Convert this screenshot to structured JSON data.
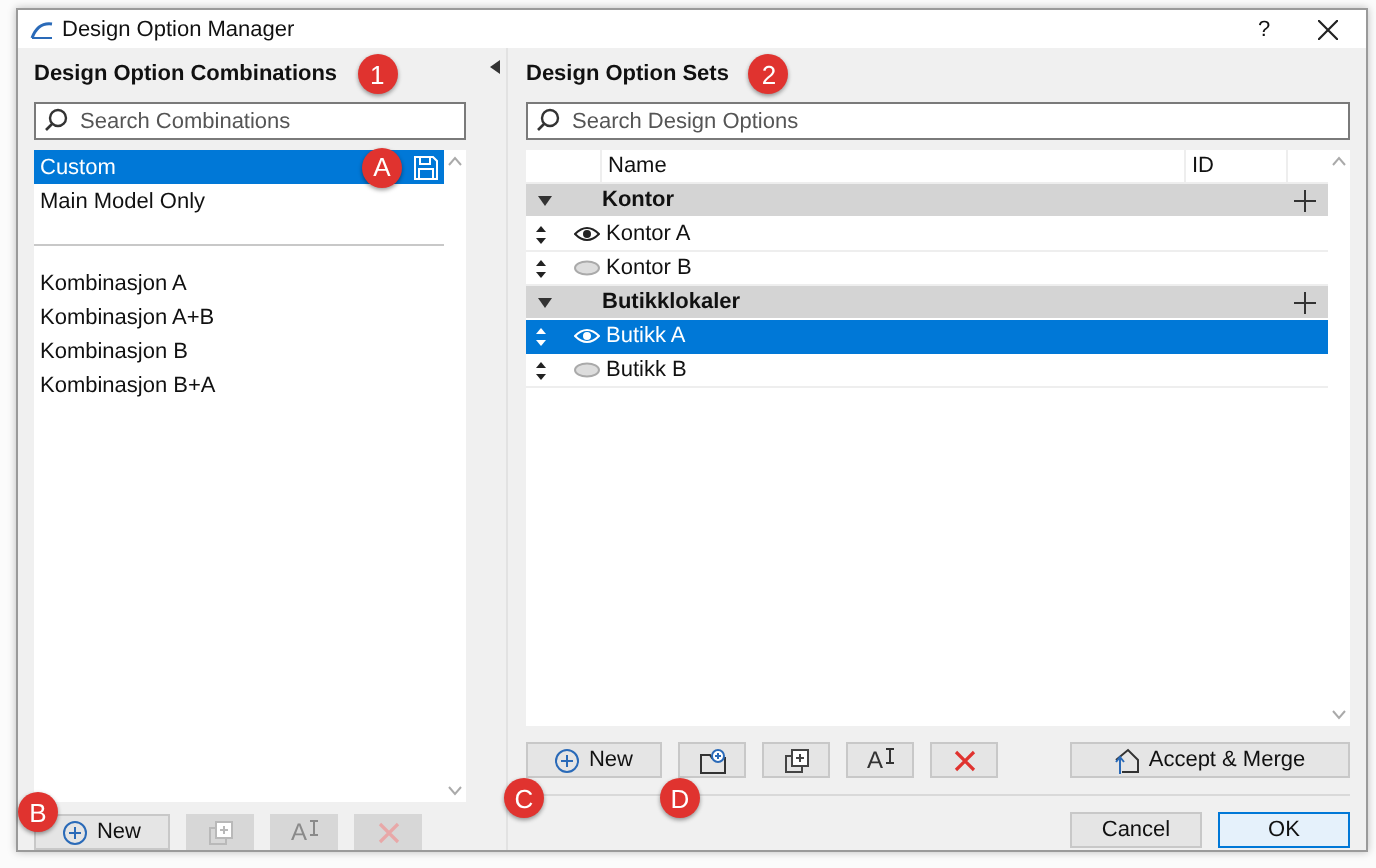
{
  "window": {
    "title": "Design Option Manager",
    "help": "?"
  },
  "combinations_panel": {
    "heading": "Design Option Combinations",
    "callout": "1",
    "search": {
      "placeholder": "Search Combinations"
    },
    "items": [
      {
        "label": "Custom",
        "selected": true,
        "callout": "A",
        "kind": "item"
      },
      {
        "label": "Main Model Only",
        "selected": false,
        "kind": "item"
      },
      {
        "kind": "separator"
      },
      {
        "label": "Kombinasjon A",
        "selected": false,
        "kind": "item"
      },
      {
        "label": "Kombinasjon A+B",
        "selected": false,
        "kind": "item"
      },
      {
        "label": "Kombinasjon B",
        "selected": false,
        "kind": "item"
      },
      {
        "label": "Kombinasjon B+A",
        "selected": false,
        "kind": "item"
      }
    ],
    "buttons": [
      {
        "kind": "new",
        "label": "New",
        "disabled": false,
        "callout": "B"
      },
      {
        "kind": "duplicate",
        "disabled": true
      },
      {
        "kind": "rename",
        "glyph": "A",
        "disabled": true
      },
      {
        "kind": "delete",
        "disabled": true
      }
    ]
  },
  "sets_panel": {
    "heading": "Design Option Sets",
    "callout": "2",
    "search": {
      "placeholder": "Search Design Options"
    },
    "columns": [
      "Name",
      "ID"
    ],
    "sets": [
      {
        "name": "Kontor",
        "expanded": true,
        "options": [
          {
            "name": "Kontor A",
            "visible": true,
            "selected": false
          },
          {
            "name": "Kontor B",
            "visible": false,
            "selected": false
          }
        ]
      },
      {
        "name": "Butikklokaler",
        "expanded": true,
        "options": [
          {
            "name": "Butikk A",
            "visible": true,
            "selected": true
          },
          {
            "name": "Butikk B",
            "visible": false,
            "selected": false
          }
        ]
      }
    ],
    "buttons": [
      {
        "kind": "new",
        "label": "New",
        "disabled": false,
        "callout": "C"
      },
      {
        "kind": "new-set",
        "disabled": false,
        "callout": "D"
      },
      {
        "kind": "duplicate",
        "disabled": false
      },
      {
        "kind": "rename",
        "glyph": "A",
        "disabled": false
      },
      {
        "kind": "delete",
        "disabled": false
      }
    ],
    "accept": "Accept & Merge"
  },
  "footer": {
    "cancel": "Cancel",
    "ok": "OK"
  }
}
